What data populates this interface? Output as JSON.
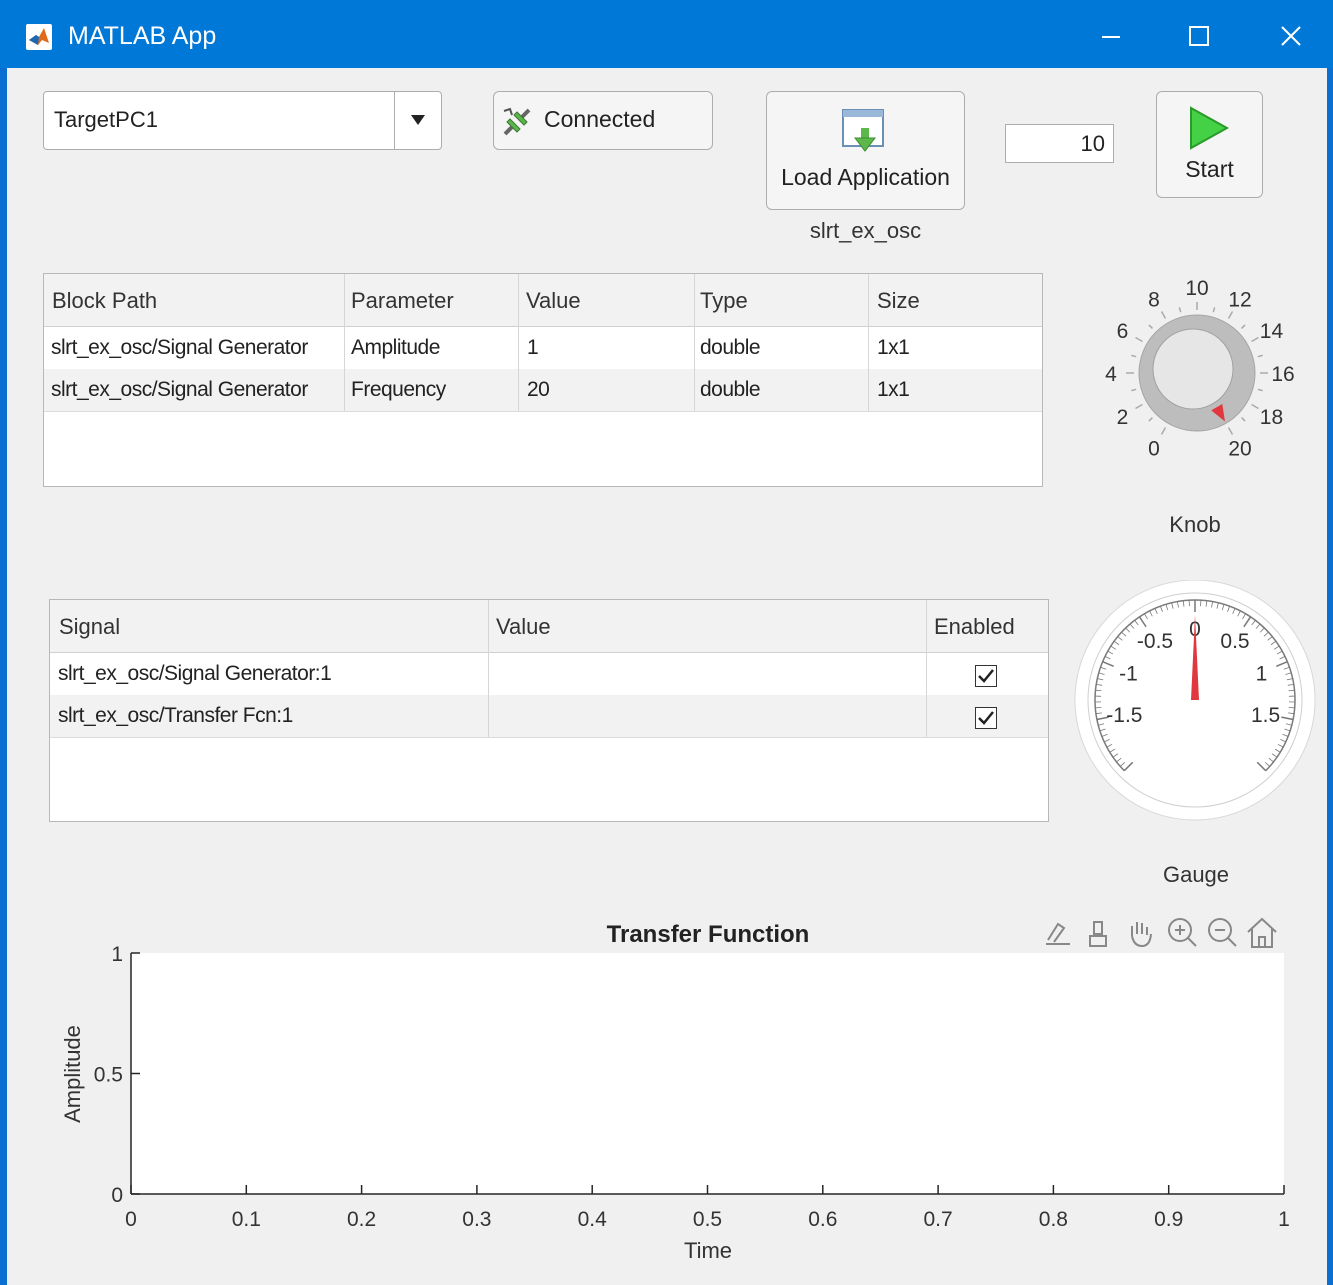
{
  "window": {
    "title": "MATLAB App"
  },
  "target": {
    "selected": "TargetPC1"
  },
  "connect": {
    "label": "Connected"
  },
  "load": {
    "label": "Load Application",
    "app_name": "slrt_ex_osc"
  },
  "stop_time": {
    "value": "10"
  },
  "start": {
    "label": "Start"
  },
  "param_table": {
    "headers": [
      "Block Path",
      "Parameter",
      "Value",
      "Type",
      "Size"
    ],
    "rows": [
      [
        "slrt_ex_osc/Signal Generator",
        "Amplitude",
        "1",
        "double",
        "1x1"
      ],
      [
        "slrt_ex_osc/Signal Generator",
        "Frequency",
        "20",
        "double",
        "1x1"
      ]
    ]
  },
  "signal_table": {
    "headers": [
      "Signal",
      "Value",
      "Enabled"
    ],
    "rows": [
      {
        "signal": "slrt_ex_osc/Signal Generator:1",
        "value": "",
        "enabled": true
      },
      {
        "signal": "slrt_ex_osc/Transfer Fcn:1",
        "value": "",
        "enabled": true
      }
    ]
  },
  "knob": {
    "label": "Knob",
    "ticks": [
      "0",
      "2",
      "4",
      "6",
      "8",
      "10",
      "12",
      "14",
      "16",
      "18",
      "20"
    ],
    "value": 20
  },
  "gauge": {
    "label": "Gauge",
    "ticks": [
      "-1.5",
      "-1",
      "-0.5",
      "0",
      "0.5",
      "1",
      "1.5"
    ],
    "value": 0
  },
  "chart_data": {
    "type": "line",
    "title": "Transfer Function",
    "xlabel": "Time",
    "ylabel": "Amplitude",
    "xlim": [
      0,
      1
    ],
    "ylim": [
      0,
      1
    ],
    "xticks": [
      "0",
      "0.1",
      "0.2",
      "0.3",
      "0.4",
      "0.5",
      "0.6",
      "0.7",
      "0.8",
      "0.9",
      "1"
    ],
    "yticks": [
      "0",
      "0.5",
      "1"
    ],
    "series": []
  },
  "axes_toolbar": [
    "export-icon",
    "brush-icon",
    "pan-icon",
    "zoom-in-icon",
    "zoom-out-icon",
    "home-icon"
  ],
  "colors": {
    "titlebar": "#0078d7",
    "accent_red": "#e0383e",
    "start_green": "#3cc43c"
  }
}
